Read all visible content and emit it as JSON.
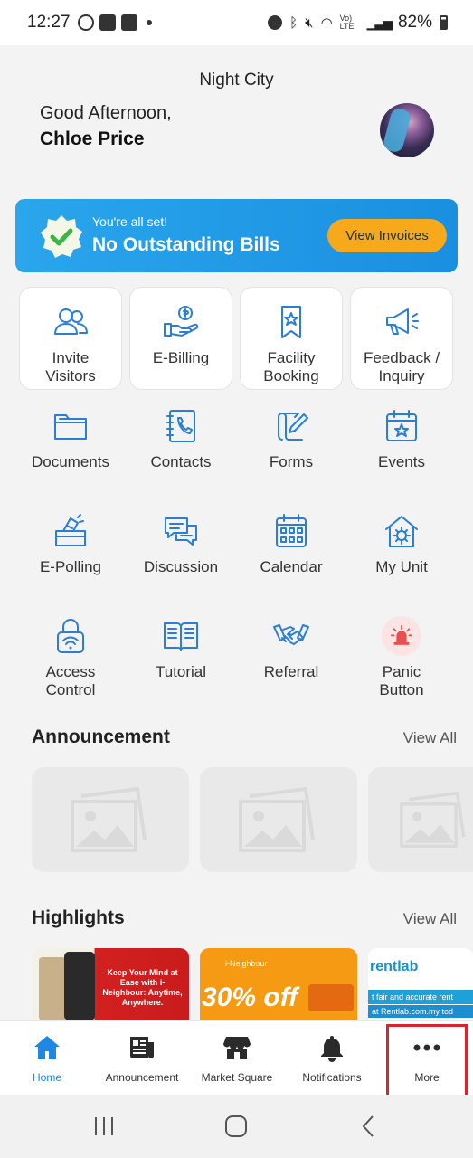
{
  "status_bar": {
    "time": "12:27",
    "battery": "82%",
    "network": "Vo) LTE"
  },
  "header": {
    "location": "Night City",
    "greeting": "Good Afternoon,",
    "user_name": "Chloe Price"
  },
  "bill_banner": {
    "status": "You're all set!",
    "message": "No Outstanding Bills",
    "button_label": "View Invoices",
    "accent": "#f7a91c"
  },
  "quick_actions": [
    {
      "label": "Invite\nVisitors",
      "icon": "invite-visitors-icon"
    },
    {
      "label": "E-Billing",
      "icon": "e-billing-icon"
    },
    {
      "label": "Facility\nBooking",
      "icon": "facility-booking-icon"
    },
    {
      "label": "Feedback /\nInquiry",
      "icon": "megaphone-icon"
    }
  ],
  "menu_grid": [
    {
      "label": "Documents",
      "icon": "folder-icon"
    },
    {
      "label": "Contacts",
      "icon": "phonebook-icon"
    },
    {
      "label": "Forms",
      "icon": "forms-icon"
    },
    {
      "label": "Events",
      "icon": "calendar-star-icon"
    },
    {
      "label": "E-Polling",
      "icon": "ballot-box-icon"
    },
    {
      "label": "Discussion",
      "icon": "chat-bubbles-icon"
    },
    {
      "label": "Calendar",
      "icon": "calendar-icon"
    },
    {
      "label": "My Unit",
      "icon": "house-gear-icon"
    },
    {
      "label": "Access\nControl",
      "icon": "lock-wifi-icon"
    },
    {
      "label": "Tutorial",
      "icon": "book-icon"
    },
    {
      "label": "Referral",
      "icon": "handshake-icon"
    },
    {
      "label": "Panic\nButton",
      "icon": "siren-icon"
    }
  ],
  "announcement": {
    "title": "Announcement",
    "view_all": "View All"
  },
  "highlights": {
    "title": "Highlights",
    "view_all": "View All",
    "cards": [
      {
        "text": "Keep Your Mind at Ease with i-Neighbour: Anytime, Anywhere."
      },
      {
        "brand": "i-Neighbour",
        "text": "30% off"
      },
      {
        "brand": "rentlab",
        "line1": "t fair and accurate rent",
        "line2": "at Rentlab.com.my tod"
      }
    ]
  },
  "bottom_nav": [
    {
      "label": "Home",
      "icon": "home-icon",
      "active": true
    },
    {
      "label": "Announcement",
      "icon": "newspaper-icon",
      "active": false
    },
    {
      "label": "Market Square",
      "icon": "store-icon",
      "active": false
    },
    {
      "label": "Notifications",
      "icon": "bell-icon",
      "active": false
    },
    {
      "label": "More",
      "icon": "more-dots-icon",
      "active": false
    }
  ],
  "colors": {
    "primary": "#2a7fd4",
    "banner": "#1f9ae6",
    "highlight_box": "#d8262f"
  }
}
